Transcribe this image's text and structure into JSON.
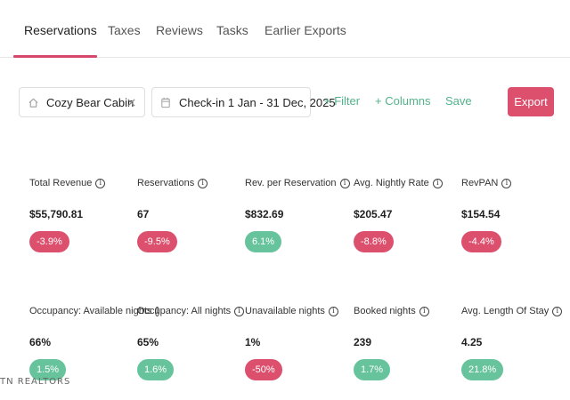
{
  "tabs": [
    {
      "label": "Reservations",
      "active": true
    },
    {
      "label": "Taxes"
    },
    {
      "label": "Reviews"
    },
    {
      "label": "Tasks"
    },
    {
      "label": "Earlier Exports"
    }
  ],
  "toolbar": {
    "property": "Cozy Bear Cabin",
    "property_icon": "home-icon",
    "clear_icon": "close-icon",
    "date_range": "Check-in 1 Jan - 31 Dec, 2025",
    "date_icon": "calendar-icon",
    "filter": "+ Filter",
    "columns": "+ Columns",
    "save": "Save",
    "export": "Export"
  },
  "metrics": [
    {
      "label": "Total Revenue",
      "value": "$55,790.81",
      "change": "-3.9%",
      "trend": "negative"
    },
    {
      "label": "Reservations",
      "value": "67",
      "change": "-9.5%",
      "trend": "negative"
    },
    {
      "label": "Rev. per Reservation",
      "value": "$832.69",
      "change": "6.1%",
      "trend": "positive"
    },
    {
      "label": "Avg. Nightly Rate",
      "value": "$205.47",
      "change": "-8.8%",
      "trend": "negative"
    },
    {
      "label": "RevPAN",
      "value": "$154.54",
      "change": "-4.4%",
      "trend": "negative"
    },
    {
      "label": "Occupancy: Available nights",
      "value": "66%",
      "change": "1.5%",
      "trend": "positive"
    },
    {
      "label": "Occupancy: All nights",
      "value": "65%",
      "change": "1.6%",
      "trend": "positive"
    },
    {
      "label": "Unavailable nights",
      "value": "1%",
      "change": "-50%",
      "trend": "negative"
    },
    {
      "label": "Booked nights",
      "value": "239",
      "change": "1.7%",
      "trend": "positive"
    },
    {
      "label": "Avg. Length Of Stay",
      "value": "4.25",
      "change": "21.8%",
      "trend": "positive"
    }
  ],
  "info_glyph": "i",
  "watermark": "TN REALTORS",
  "colors": {
    "accent": "#d6456a",
    "negative": "#dc4f6d",
    "positive": "#67c39b",
    "link": "#52b38a"
  }
}
